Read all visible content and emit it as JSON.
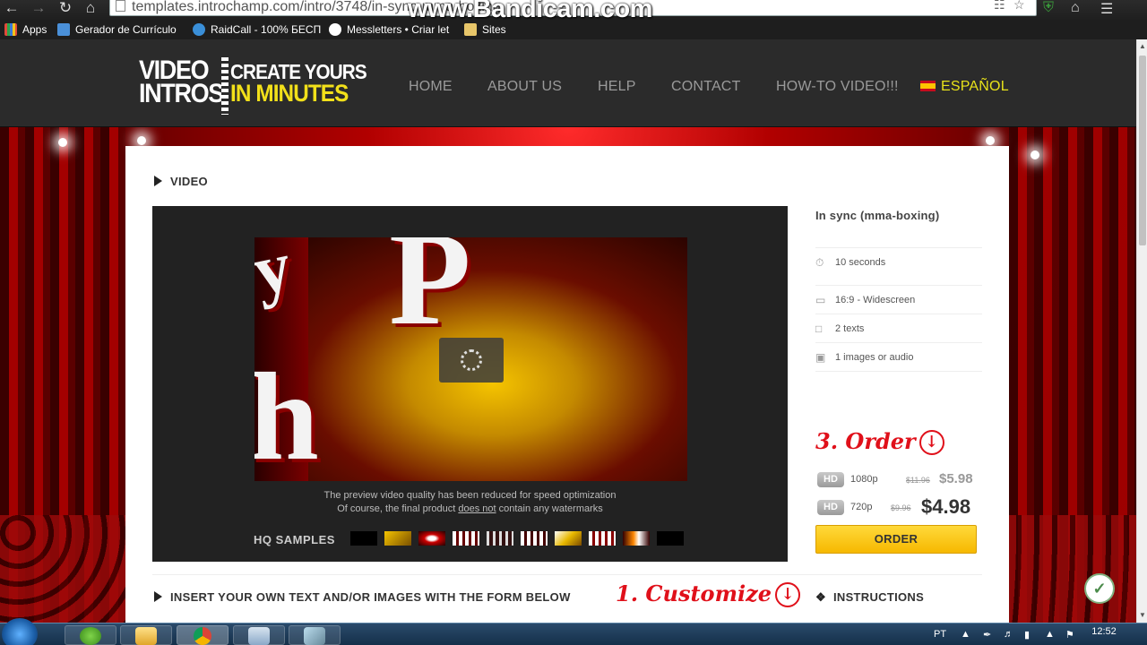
{
  "browser": {
    "url": "templates.introchamp.com/intro/3748/in-sync-mma-boxing",
    "watermark": "www.Bandicam.com",
    "back_icon": "back-arrow-icon",
    "forward_icon": "forward-arrow-icon",
    "reload_icon": "reload-icon",
    "home_icon": "home-icon"
  },
  "bookmarks": [
    {
      "label": "Apps",
      "color": "#e04a3a"
    },
    {
      "label": "Gerador de Currículo",
      "color": "#4a90d9"
    },
    {
      "label": "RaidCall - 100% БЕСП",
      "color": "#3a8fd8"
    },
    {
      "label": "Messletters • Criar let",
      "color": "#ffffff"
    },
    {
      "label": "Sites",
      "color": "#e8c66a"
    }
  ],
  "site": {
    "logo_left": "VIDEO INTROS",
    "logo_right_line1": "CREATE YOURS",
    "logo_right_line2": "IN MINUTES",
    "nav": [
      {
        "label": "HOME"
      },
      {
        "label": "ABOUT US"
      },
      {
        "label": "HELP"
      },
      {
        "label": "CONTACT"
      },
      {
        "label": "HOW-TO VIDEO!!!"
      },
      {
        "label": "ESPAÑOL"
      }
    ]
  },
  "main": {
    "video_section": "VIDEO",
    "note_line1": "The preview video quality has been reduced for speed optimization",
    "note_line2_pre": "Of course, the final product ",
    "note_line2_link": "does not",
    "note_line2_post": " contain any watermarks",
    "hq_samples": "HQ SAMPLES",
    "template_title": "In sync (mma-boxing)",
    "specs": [
      {
        "icon": "stopwatch-icon",
        "text": "10 seconds"
      },
      {
        "icon": "monitor-icon",
        "text": "16:9 - Widescreen"
      },
      {
        "icon": "speech-bubble-icon",
        "text": "2 texts"
      },
      {
        "icon": "camera-icon",
        "text": "1 images or audio"
      }
    ],
    "order_annotation": "3. Order",
    "prices": [
      {
        "badge": "HD",
        "res": "1080p",
        "old": "$11.96",
        "new": "$5.98"
      },
      {
        "badge": "HD",
        "res": "720p",
        "old": "$9.96",
        "new": "$4.98"
      }
    ],
    "order_button": "ORDER",
    "insert_section": "INSERT YOUR OWN TEXT AND/OR IMAGES WITH THE FORM BELOW",
    "customize_annotation": "1. Customize",
    "instructions": "INSTRUCTIONS"
  },
  "taskbar": {
    "language": "PT",
    "time": "12:52"
  }
}
